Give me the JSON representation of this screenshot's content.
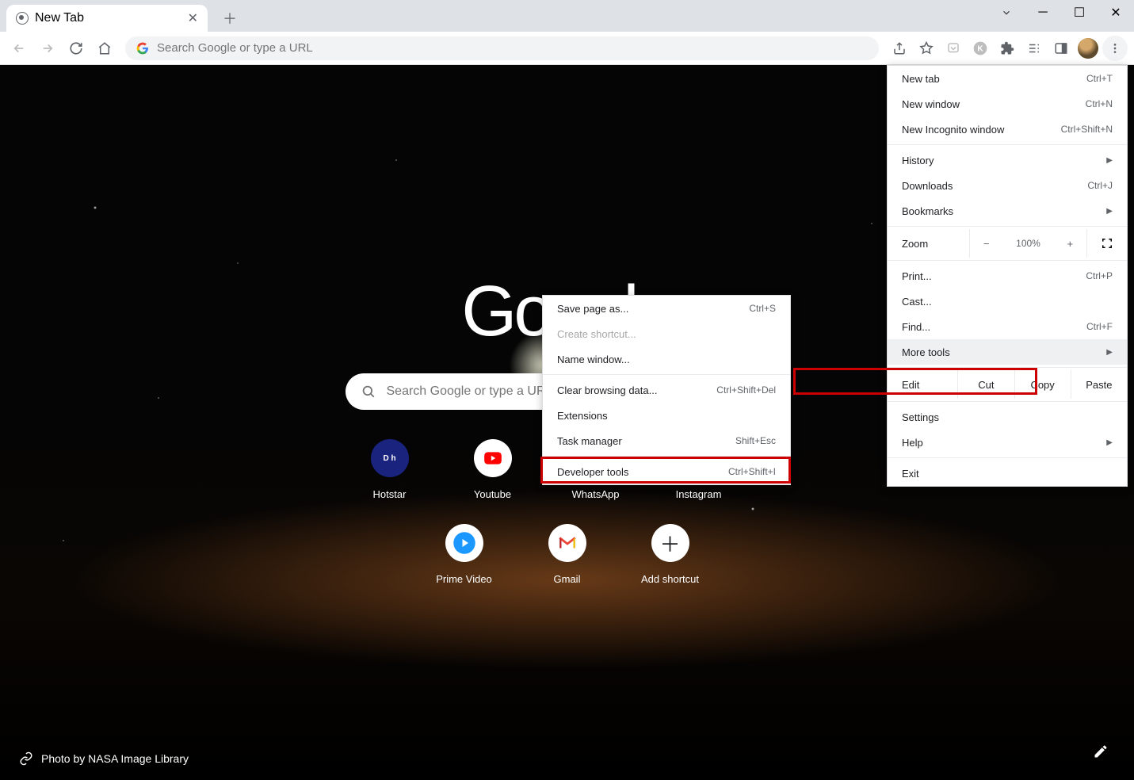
{
  "tab": {
    "title": "New Tab"
  },
  "omnibox": {
    "placeholder": "Search Google or type a URL"
  },
  "google": {
    "logo_text": "Google",
    "search_placeholder": "Search Google or type a URL"
  },
  "shortcuts": {
    "row1": [
      {
        "label": "Hotstar",
        "icon": "disney-hotstar"
      },
      {
        "label": "Youtube",
        "icon": "youtube"
      },
      {
        "label": "WhatsApp",
        "icon": "whatsapp"
      },
      {
        "label": "Instagram",
        "icon": "instagram"
      }
    ],
    "row2": [
      {
        "label": "Prime Video",
        "icon": "prime-video"
      },
      {
        "label": "Gmail",
        "icon": "gmail"
      },
      {
        "label": "Add shortcut",
        "icon": "add"
      }
    ]
  },
  "credit": "Photo by NASA Image Library",
  "menu": {
    "new_tab": {
      "label": "New tab",
      "shortcut": "Ctrl+T"
    },
    "new_window": {
      "label": "New window",
      "shortcut": "Ctrl+N"
    },
    "incognito": {
      "label": "New Incognito window",
      "shortcut": "Ctrl+Shift+N"
    },
    "history": {
      "label": "History"
    },
    "downloads": {
      "label": "Downloads",
      "shortcut": "Ctrl+J"
    },
    "bookmarks": {
      "label": "Bookmarks"
    },
    "zoom": {
      "label": "Zoom",
      "value": "100%"
    },
    "print": {
      "label": "Print...",
      "shortcut": "Ctrl+P"
    },
    "cast": {
      "label": "Cast..."
    },
    "find": {
      "label": "Find...",
      "shortcut": "Ctrl+F"
    },
    "more_tools": {
      "label": "More tools"
    },
    "edit": {
      "label": "Edit",
      "cut": "Cut",
      "copy": "Copy",
      "paste": "Paste"
    },
    "settings": {
      "label": "Settings"
    },
    "help": {
      "label": "Help"
    },
    "exit": {
      "label": "Exit"
    }
  },
  "submenu": {
    "save_page": {
      "label": "Save page as...",
      "shortcut": "Ctrl+S"
    },
    "create_shortcut": {
      "label": "Create shortcut..."
    },
    "name_window": {
      "label": "Name window..."
    },
    "clear_browsing": {
      "label": "Clear browsing data...",
      "shortcut": "Ctrl+Shift+Del"
    },
    "extensions": {
      "label": "Extensions"
    },
    "task_manager": {
      "label": "Task manager",
      "shortcut": "Shift+Esc"
    },
    "dev_tools": {
      "label": "Developer tools",
      "shortcut": "Ctrl+Shift+I"
    }
  }
}
